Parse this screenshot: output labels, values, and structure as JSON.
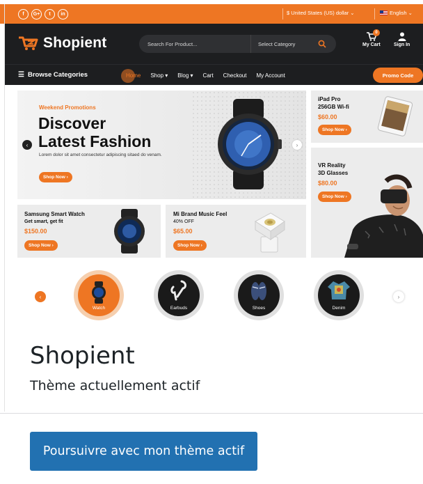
{
  "topbar": {
    "social": [
      "f",
      "G+",
      "t",
      "in"
    ],
    "currency": "$ United States (US) dollar ⌄",
    "language": "English ⌄"
  },
  "header": {
    "logo": "Shopient",
    "search_placeholder": "Search For Product...",
    "category": "Select Category",
    "cart_label": "My Cart",
    "cart_count": "0",
    "signin_label": "Sign In"
  },
  "nav": {
    "browse": "Browse Categories",
    "menu": [
      "Home",
      "Shop",
      "Blog",
      "Cart",
      "Checkout",
      "My Account"
    ],
    "promo": "Promo Code"
  },
  "hero": {
    "label": "Weekend Promotions",
    "title_line1": "Discover",
    "title_line2": "Latest Fashion",
    "subtitle": "Lorem dolor sit amet consectetur adipiscing sitaed do venam.",
    "button": "Shop Now ›"
  },
  "cards": {
    "ipad": {
      "title1": "iPad Pro",
      "title2": "256GB Wi-fi",
      "price": "$60.00",
      "button": "Shop Now ›"
    },
    "vr": {
      "title1": "VR Reality",
      "title2": "3D Glasses",
      "price": "$80.00",
      "button": "Shop Now ›"
    },
    "watch": {
      "title": "Samsung Smart Watch",
      "sub": "Get smart, get fit",
      "price": "$150.00",
      "button": "Shop Now ›"
    },
    "music": {
      "title": "Mi Brand Music Feel",
      "sub": "40% OFF",
      "price": "$65.00",
      "button": "Shop Now ›"
    }
  },
  "categories": [
    "Watch",
    "Earbuds",
    "Shoes",
    "Denim"
  ],
  "theme": {
    "name": "Shopient",
    "status": "Thème actuellement actif",
    "continue": "Poursuivre avec mon thème actif"
  },
  "colors": {
    "accent": "#ee7623",
    "dark": "#1d1e20",
    "wp_blue": "#2271b1"
  }
}
